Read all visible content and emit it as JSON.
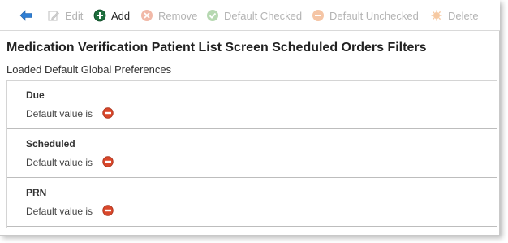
{
  "toolbar": {
    "edit_label": "Edit",
    "add_label": "Add",
    "remove_label": "Remove",
    "default_checked_label": "Default Checked",
    "default_unchecked_label": "Default Unchecked",
    "delete_label": "Delete"
  },
  "page": {
    "title": "Medication Verification Patient List Screen Scheduled Orders Filters",
    "subtitle": "Loaded Default Global Preferences"
  },
  "rows": [
    {
      "name": "Due",
      "default_text": "Default value is",
      "default_icon": "minus-circle-icon"
    },
    {
      "name": "Scheduled",
      "default_text": "Default value is",
      "default_icon": "minus-circle-icon"
    },
    {
      "name": "PRN",
      "default_text": "Default value is",
      "default_icon": "minus-circle-icon"
    }
  ],
  "colors": {
    "back_arrow": "#2f7fd4",
    "add_icon": "#1e6f3d",
    "disabled_text": "#b4b4b4",
    "minus_badge": "#d9472b"
  }
}
